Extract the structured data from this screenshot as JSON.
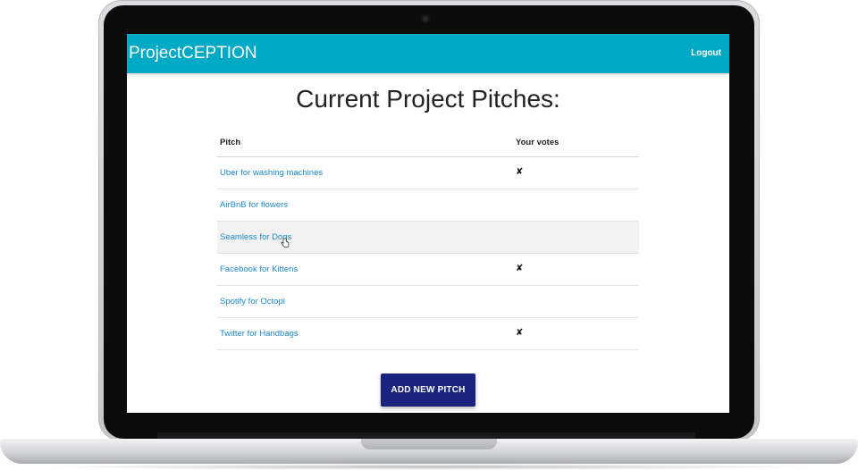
{
  "app": {
    "brand": "ProjectCEPTION",
    "logout_label": "Logout",
    "accent_color": "#00a9c4"
  },
  "page": {
    "title": "Current Project Pitches:"
  },
  "table": {
    "headers": {
      "pitch": "Pitch",
      "votes": "Your votes"
    },
    "rows": [
      {
        "pitch": "Uber for washing machines",
        "vote": "✘"
      },
      {
        "pitch": "AirBnB for flowers",
        "vote": ""
      },
      {
        "pitch": "Seamless for Dogs",
        "vote": ""
      },
      {
        "pitch": "Facebook for Kittens",
        "vote": "✘"
      },
      {
        "pitch": "Spotify for Octopi",
        "vote": ""
      },
      {
        "pitch": "Twitter for Handbags",
        "vote": "✘"
      }
    ]
  },
  "actions": {
    "add_label": "ADD NEW PITCH",
    "button_color": "#1a237e"
  },
  "icons": {
    "vote_mark": "x-mark-icon",
    "pointer": "hand-pointer-icon"
  }
}
